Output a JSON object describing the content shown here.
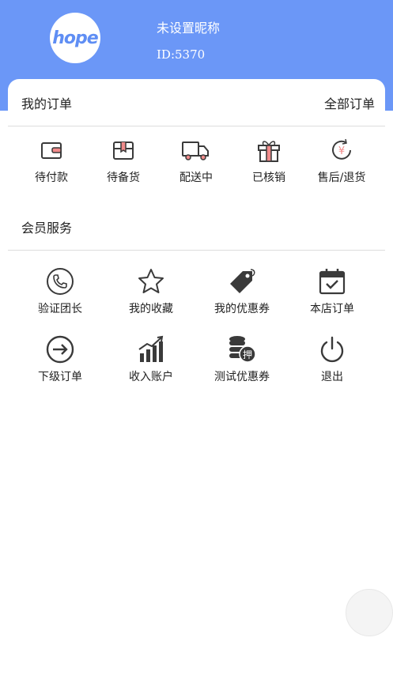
{
  "profile": {
    "avatar_text": "hope",
    "nickname": "未设置昵称",
    "user_id": "ID:5370"
  },
  "orders": {
    "title": "我的订单",
    "all_label": "全部订单",
    "items": [
      {
        "label": "待付款",
        "icon": "wallet-icon"
      },
      {
        "label": "待备货",
        "icon": "gift-box-icon"
      },
      {
        "label": "配送中",
        "icon": "truck-icon"
      },
      {
        "label": "已核销",
        "icon": "gift-icon"
      },
      {
        "label": "售后/退货",
        "icon": "yen-refund-icon"
      }
    ]
  },
  "services": {
    "title": "会员服务",
    "items": [
      {
        "label": "验证团长",
        "icon": "phone-icon"
      },
      {
        "label": "我的收藏",
        "icon": "star-icon"
      },
      {
        "label": "我的优惠券",
        "icon": "tag-icon"
      },
      {
        "label": "本店订单",
        "icon": "calendar-check-icon"
      },
      {
        "label": "下级订单",
        "icon": "arrow-right-circle-icon"
      },
      {
        "label": "收入账户",
        "icon": "chart-growth-icon"
      },
      {
        "label": "测试优惠券",
        "icon": "coins-icon"
      },
      {
        "label": "退出",
        "icon": "power-icon"
      }
    ],
    "coin_badge": "押"
  },
  "colors": {
    "header": "#6b97f7",
    "accent_pink": "#f28b8b",
    "icon_dark": "#3a3a3a"
  }
}
